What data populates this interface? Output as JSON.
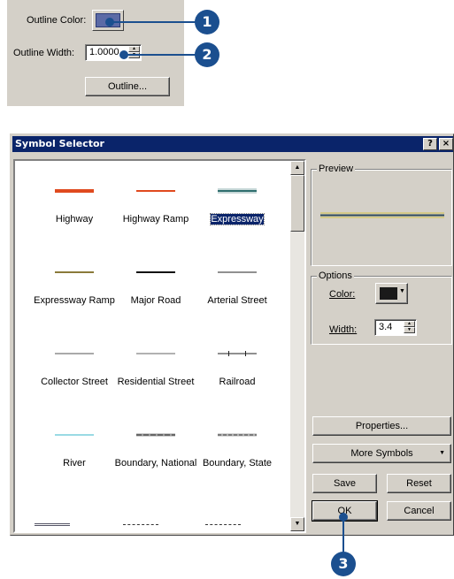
{
  "snippet": {
    "outline_color_label": "Outline Color:",
    "outline_width_label": "Outline Width:",
    "outline_width_value": "1.0000",
    "outline_button": "Outline..."
  },
  "callouts": [
    "1",
    "2",
    "3"
  ],
  "dialog": {
    "title": "Symbol Selector",
    "help_button": "?",
    "symbols": [
      {
        "label": "Highway",
        "style": "highway"
      },
      {
        "label": "Highway Ramp",
        "style": "highway-ramp"
      },
      {
        "label": "Expressway",
        "style": "expressway",
        "selected": true
      },
      {
        "label": "Expressway Ramp",
        "style": "expressway-ramp"
      },
      {
        "label": "Major Road",
        "style": "major-road"
      },
      {
        "label": "Arterial Street",
        "style": "arterial-street"
      },
      {
        "label": "Collector Street",
        "style": "collector-street"
      },
      {
        "label": "Residential Street",
        "style": "residential-street"
      },
      {
        "label": "Railroad",
        "style": "railroad"
      },
      {
        "label": "River",
        "style": "river"
      },
      {
        "label": "Boundary, National",
        "style": "boundary-national"
      },
      {
        "label": "Boundary, State",
        "style": "boundary-state"
      }
    ],
    "preview_label": "Preview",
    "options_label": "Options",
    "color_label": "Color:",
    "color_value": "#1a1a1a",
    "width_label": "Width:",
    "width_value": "3.4",
    "properties_button": "Properties...",
    "more_symbols_button": "More Symbols",
    "save_button": "Save",
    "reset_button": "Reset",
    "ok_button": "OK",
    "cancel_button": "Cancel"
  },
  "colors": {
    "accent": "#1b4f8f",
    "titlebar": "#0a246a",
    "highway": "#e04a1f",
    "expressway": "#2f6e6e",
    "expressway_ramp": "#8a7a3a",
    "river": "#35b6c9"
  }
}
